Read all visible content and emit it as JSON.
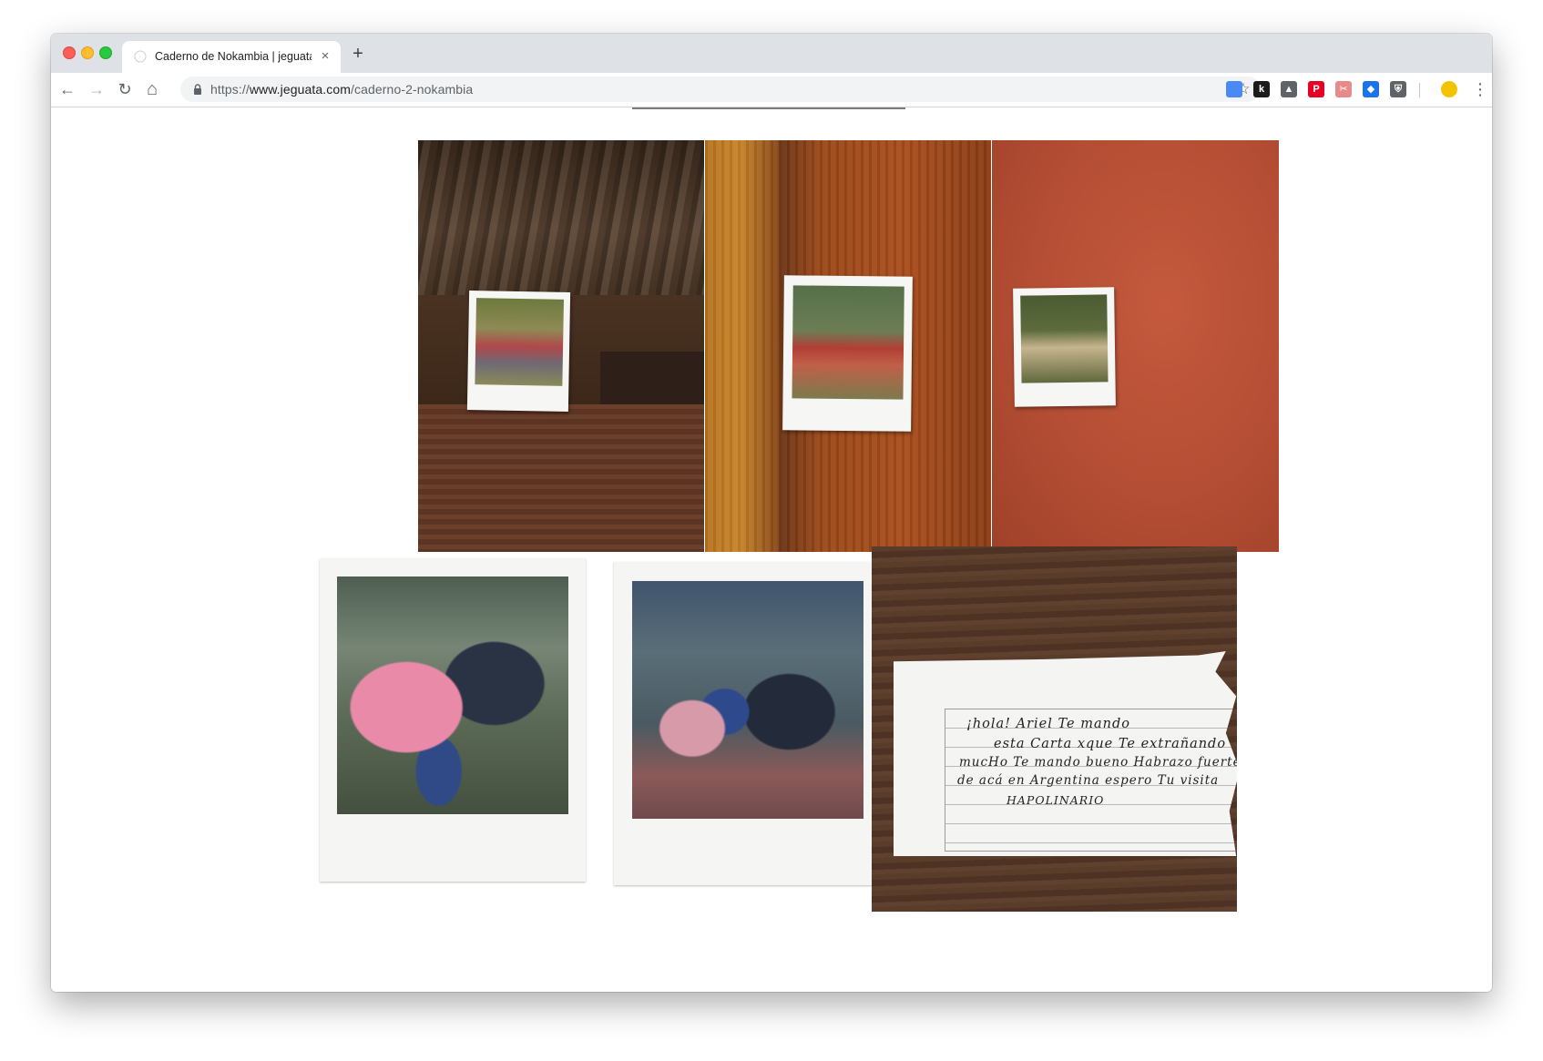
{
  "browser": {
    "tab_title": "Caderno de Nokambia | jeguata",
    "tab_close": "×",
    "new_tab": "+",
    "url_protocol": "https://",
    "url_host": "www.jeguata.com",
    "url_path": "/caderno-2-nokambia",
    "nav": {
      "back": "←",
      "forward": "→",
      "reload": "↻",
      "home": "⌂"
    },
    "star": "☆",
    "menu": "⋮"
  },
  "extensions": [
    {
      "icon": "docs-icon",
      "glyph": "",
      "color": "#4a8af4"
    },
    {
      "icon": "k-extension-icon",
      "glyph": "k",
      "color": "#1b1b1b"
    },
    {
      "icon": "drive-icon",
      "glyph": "▲",
      "color": "#5f6368"
    },
    {
      "icon": "pinterest-icon",
      "glyph": "P",
      "color": "#e60023"
    },
    {
      "icon": "clipper-icon",
      "glyph": "✂",
      "color": "#e78a8a"
    },
    {
      "icon": "bookmark-blue-icon",
      "glyph": "◆",
      "color": "#1a73e8"
    },
    {
      "icon": "shield-icon",
      "glyph": "⛨",
      "color": "#5f6368"
    },
    {
      "icon": "profile-avatar-icon",
      "glyph": "",
      "color": "#f2c400"
    }
  ],
  "note": {
    "lines": [
      "¡hola! Ariel  Te mando",
      "esta  Carta xque Te  extrañando",
      "mucHo  Te mando bueno Habrazo fuerte",
      "de  acá  en  Argentina  espero  Tu visita",
      "HAPOLINARIO"
    ]
  }
}
